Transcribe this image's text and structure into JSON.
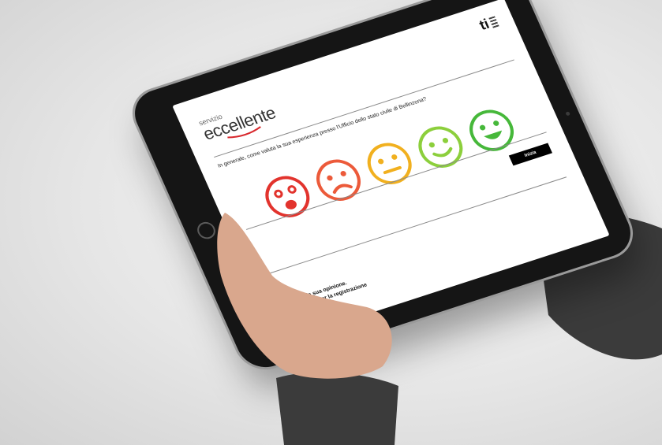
{
  "screen": {
    "brand": {
      "small": "servizio",
      "big": "eccellente"
    },
    "logo": "ti",
    "question": "In generale, come valuta la sua esperienza presso l'Ufficio dello stato civile di Bellinzona?",
    "faces": [
      {
        "name": "very-unhappy",
        "color": "#e2332d"
      },
      {
        "name": "unhappy",
        "color": "#ec5a3a"
      },
      {
        "name": "neutral",
        "color": "#f1b01f"
      },
      {
        "name": "happy",
        "color": "#8ccf3c"
      },
      {
        "name": "very-happy",
        "color": "#46b83a"
      }
    ],
    "start_label": "Inizia",
    "thanks_line1": "Grazie per la sua opinione.",
    "thanks_line2": "Premi \"Inizia\" per la registrazione"
  }
}
